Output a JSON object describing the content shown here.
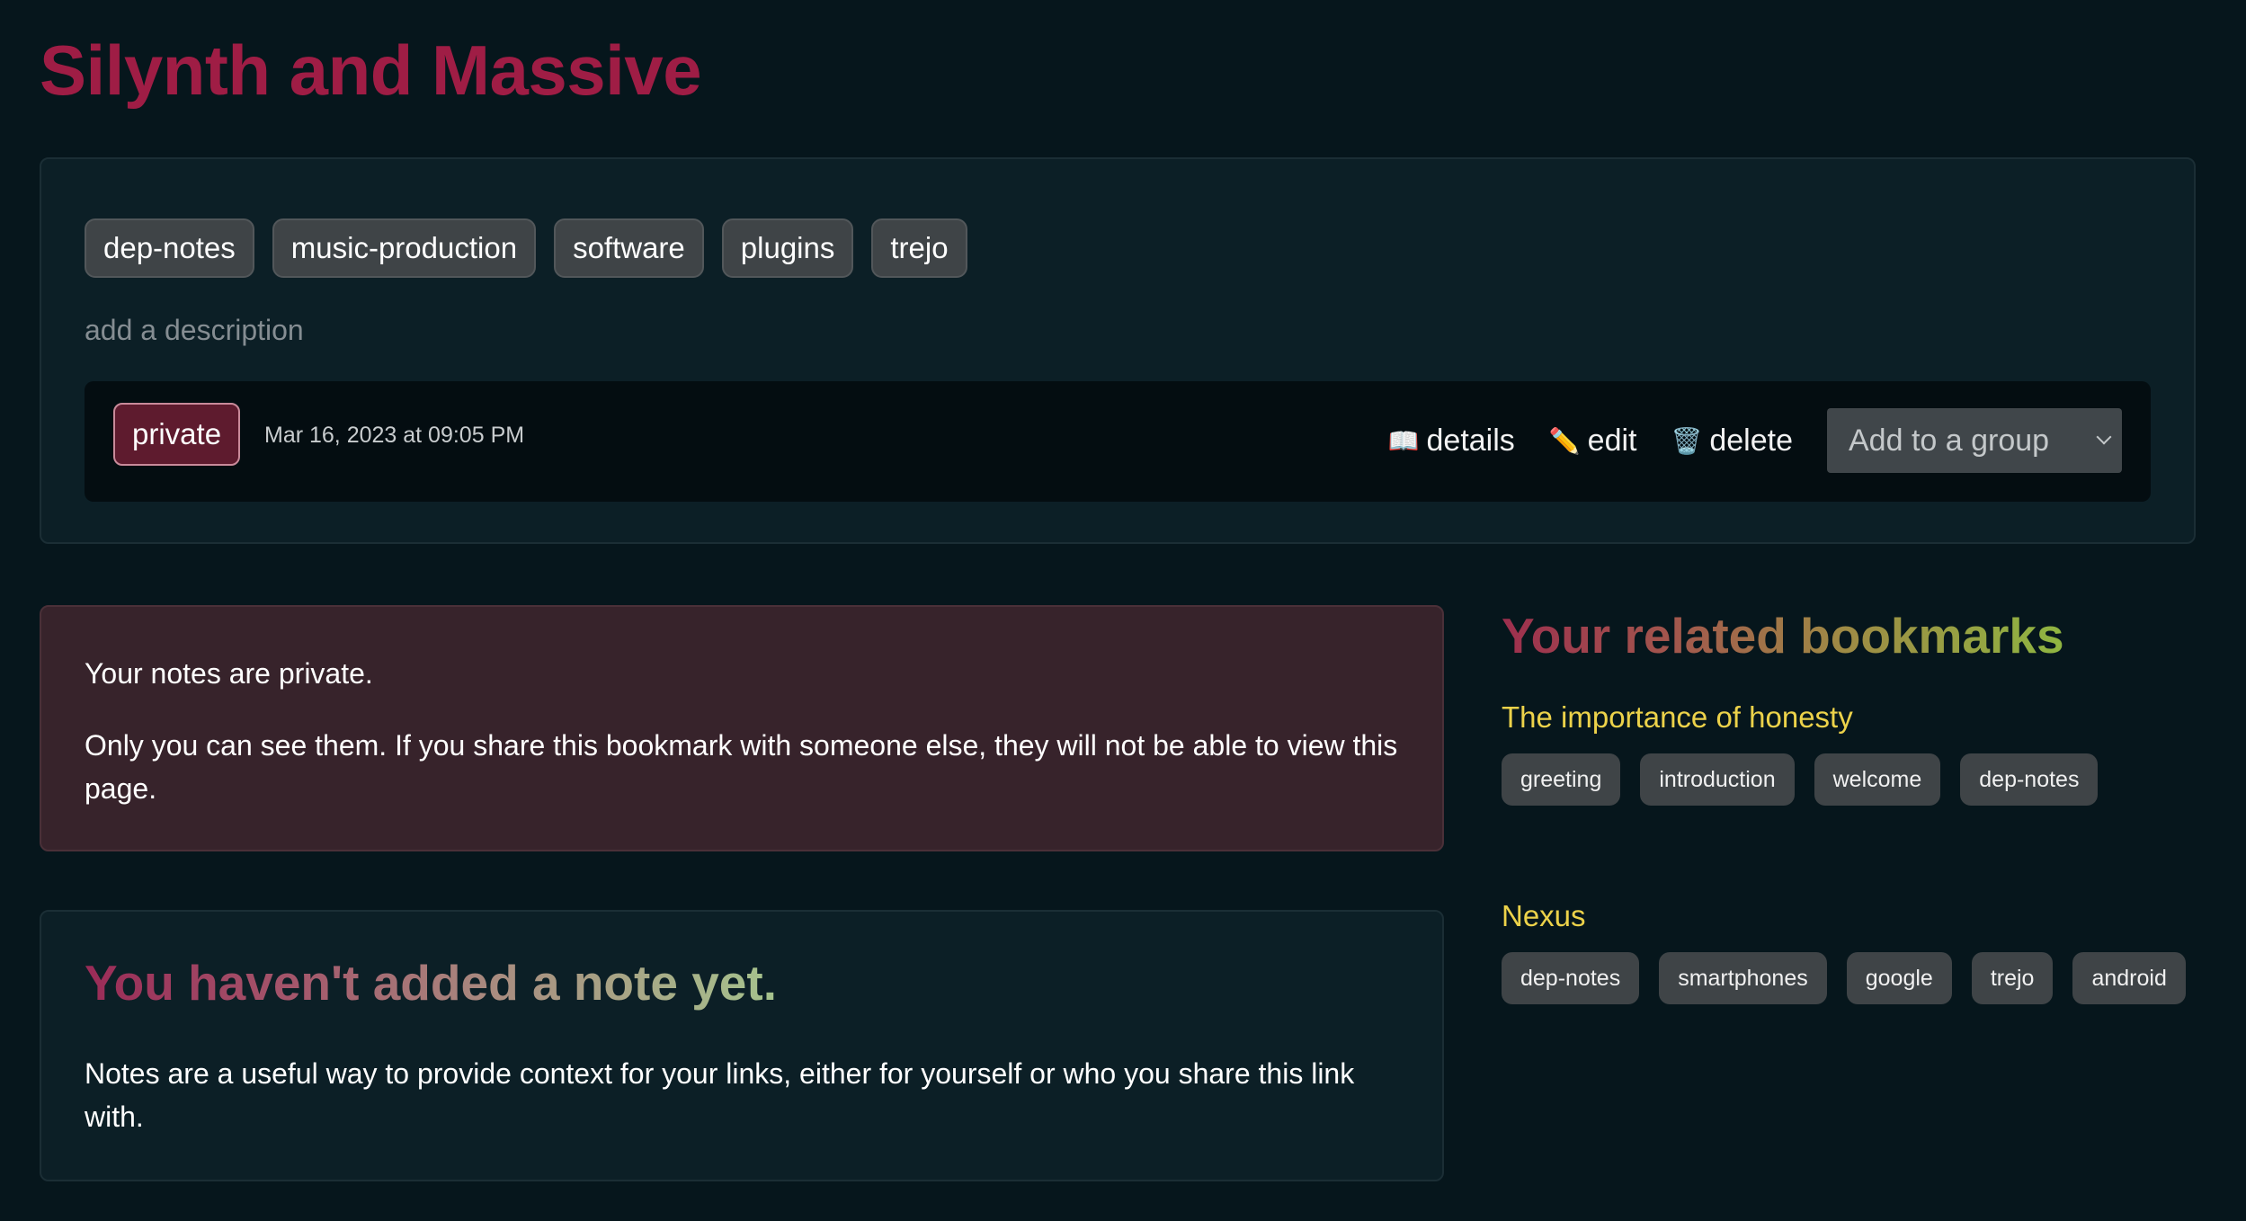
{
  "bookmark": {
    "title": "Silynth and Massive",
    "tags": [
      "dep-notes",
      "music-production",
      "software",
      "plugins",
      "trejo"
    ],
    "description_placeholder": "add a description",
    "visibility": "private",
    "created": "Mar 16, 2023 at 09:05 PM"
  },
  "actions": {
    "details_icon": "📖",
    "details_label": "details",
    "edit_icon": "✏️",
    "edit_label": "edit",
    "delete_icon": "🗑️",
    "delete_label": "delete",
    "group_select_placeholder": "Add to a group"
  },
  "privacy_notice": {
    "line1": "Your notes are private.",
    "line2": "Only you can see them. If you share this bookmark with someone else, they will not be able to view this page."
  },
  "empty_note": {
    "heading": "You haven't added a note yet.",
    "body": "Notes are a useful way to provide context for your links, either for yourself or who you share this link with."
  },
  "related": {
    "heading": "Your related bookmarks",
    "items": [
      {
        "title": "The importance of honesty",
        "tags": [
          "greeting",
          "introduction",
          "welcome",
          "dep-notes"
        ]
      },
      {
        "title": "Nexus",
        "tags": [
          "dep-notes",
          "smartphones",
          "google",
          "trejo",
          "android"
        ]
      }
    ]
  },
  "colors": {
    "background": "#06161c",
    "card": "#0c1f26",
    "title": "#9f1d45",
    "notice": "#37232b",
    "related_title": "#ecd24a",
    "tag": "#3f4447"
  }
}
